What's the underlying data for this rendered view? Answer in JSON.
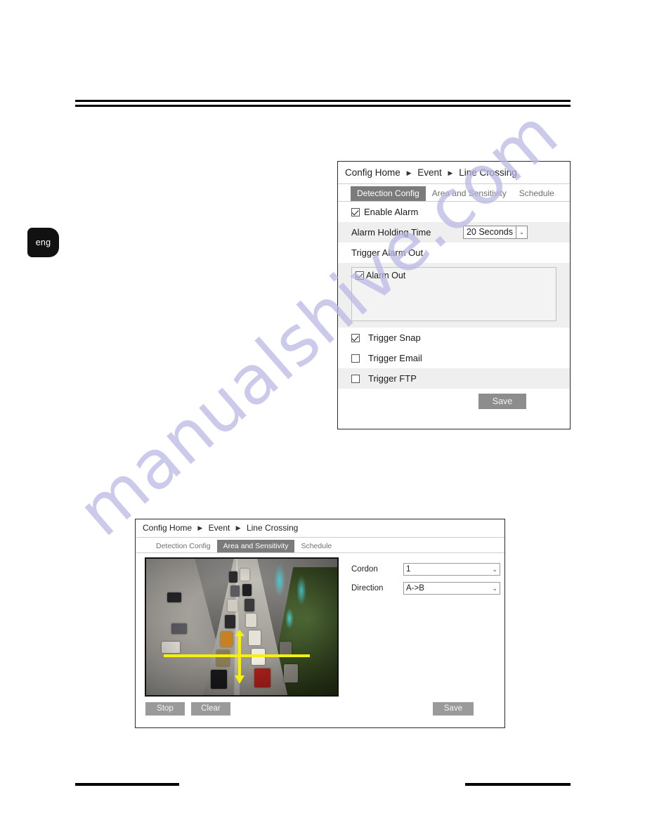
{
  "page": {
    "language_tab": "eng",
    "watermark": "manualshive.com"
  },
  "panel_detection": {
    "breadcrumb": {
      "items": [
        "Config Home",
        "Event",
        "Line Crossing"
      ],
      "separator": "▶"
    },
    "tabs": [
      {
        "label": "Detection Config",
        "active": true
      },
      {
        "label": "Area and Sensitivity",
        "active": false
      },
      {
        "label": "Schedule",
        "active": false
      }
    ],
    "rows": {
      "enable_alarm": {
        "label": "Enable Alarm",
        "checked": true
      },
      "alarm_holding_time": {
        "label": "Alarm Holding Time",
        "value": "20 Seconds",
        "chevron": "⌄"
      },
      "trigger_alarm_out": {
        "label": "Trigger Alarm Out"
      },
      "alarm_out_item": {
        "label": "Alarm Out",
        "checked": true
      },
      "trigger_snap": {
        "label": "Trigger Snap",
        "checked": true
      },
      "trigger_email": {
        "label": "Trigger Email",
        "checked": false
      },
      "trigger_ftp": {
        "label": "Trigger FTP",
        "checked": false
      }
    },
    "save_label": "Save"
  },
  "panel_area": {
    "breadcrumb": {
      "items": [
        "Config Home",
        "Event",
        "Line Crossing"
      ],
      "separator": "▶"
    },
    "tabs": [
      {
        "label": "Detection Config",
        "active": false
      },
      {
        "label": "Area and Sensitivity",
        "active": true
      },
      {
        "label": "Schedule",
        "active": false
      }
    ],
    "fields": {
      "cordon": {
        "label": "Cordon",
        "value": "1",
        "chevron": "⌄"
      },
      "direction": {
        "label": "Direction",
        "value": "A->B",
        "chevron": "⌄"
      }
    },
    "buttons": {
      "stop": "Stop",
      "clear": "Clear",
      "save": "Save"
    },
    "preview": {
      "overlay_line_color": "#f6ef12",
      "description": "live traffic camera preview with yellow cordon line and direction arrow"
    }
  }
}
